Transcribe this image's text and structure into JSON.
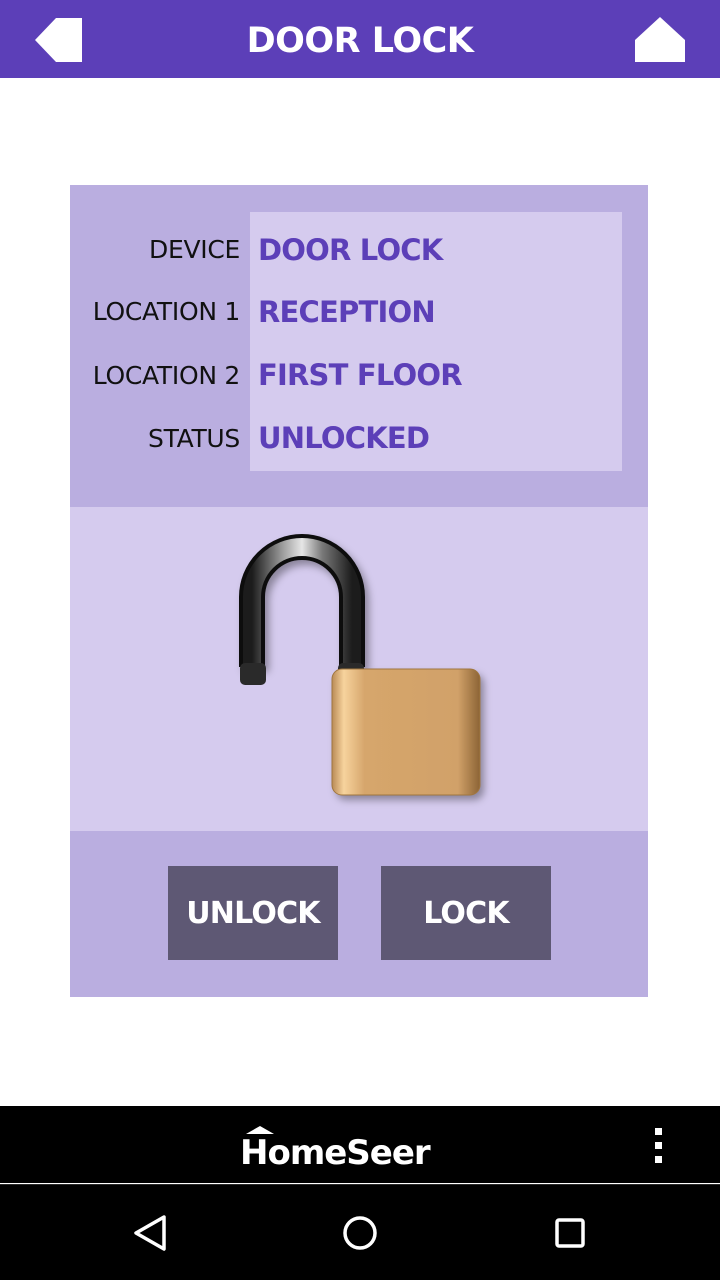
{
  "header": {
    "title": "DOOR LOCK",
    "back_icon": "back-arrow-icon",
    "home_icon": "home-icon"
  },
  "device_info": {
    "rows": [
      {
        "label": "DEVICE",
        "value": "DOOR LOCK"
      },
      {
        "label": "LOCATION 1",
        "value": "RECEPTION"
      },
      {
        "label": "LOCATION 2",
        "value": "FIRST FLOOR"
      },
      {
        "label": "STATUS",
        "value": "UNLOCKED"
      }
    ]
  },
  "status_icon": "padlock-open-icon",
  "actions": {
    "unlock_label": "UNLOCK",
    "lock_label": "LOCK"
  },
  "footer": {
    "brand": "HomeSeer",
    "menu_icon": "overflow-menu-icon"
  },
  "colors": {
    "primary": "#5c3fb8",
    "panel_dark": "#baaee0",
    "panel_light": "#d5cbee",
    "button": "#5e5874"
  }
}
